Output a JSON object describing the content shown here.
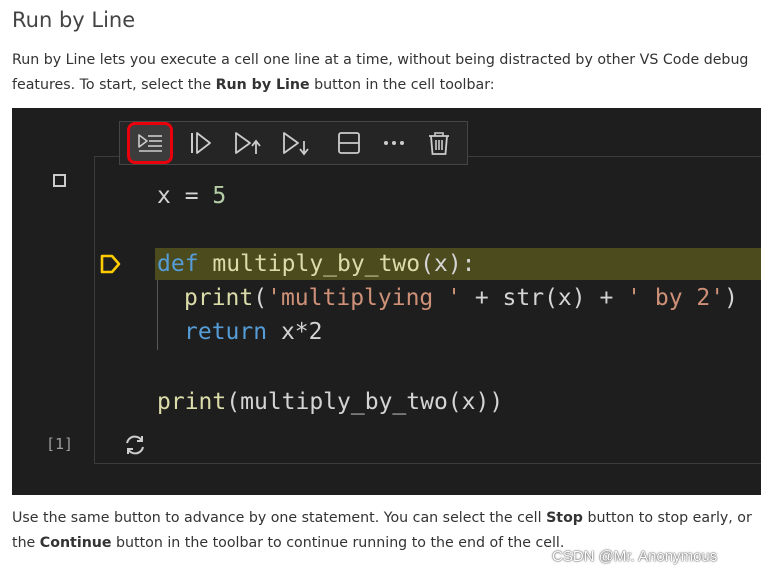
{
  "heading": "Run by Line",
  "intro": {
    "part1": "Run by Line lets you execute a cell one line at a time, without being distracted by other VS Code debug features. To start, select the ",
    "bold1": "Run by Line",
    "part2": " button in the cell toolbar:"
  },
  "toolbar": {
    "icons": [
      "run-by-line-icon",
      "continue-icon",
      "step-out-icon",
      "step-into-icon",
      "split-cell-icon",
      "more-icon",
      "delete-icon"
    ],
    "highlight_color": "#e8000d"
  },
  "code": {
    "line1": {
      "var": "x",
      "op": " = ",
      "num": "5"
    },
    "line2": {
      "kw": "def",
      "fn": "multiply_by_two",
      "rest": "(x):"
    },
    "line3": {
      "fn": "print",
      "open": "(",
      "str1": "'multiplying '",
      "mid": " + str(x) + ",
      "str2": "' by 2'",
      "close": ")"
    },
    "line4": {
      "kw": "return",
      "rest": " x*2"
    },
    "line5": {
      "fn": "print",
      "rest": "(multiply_by_two(x))"
    }
  },
  "execution_count": "[1]",
  "outro": {
    "part1": "Use the same button to advance by one statement. You can select the cell ",
    "bold1": "Stop",
    "part2": " button to stop early, or the ",
    "bold2": "Continue",
    "part3": " button in the toolbar to continue running to the end of the cell."
  },
  "watermark": "CSDN @Mr. Anonymous",
  "colors": {
    "editor_bg": "#1e1e1e",
    "keyword": "#569cd6",
    "function": "#dcdcaa",
    "string": "#ce9178",
    "number": "#b5cea8",
    "breakpoint": "#ffcc00",
    "current_line": "#4b4b1e"
  }
}
